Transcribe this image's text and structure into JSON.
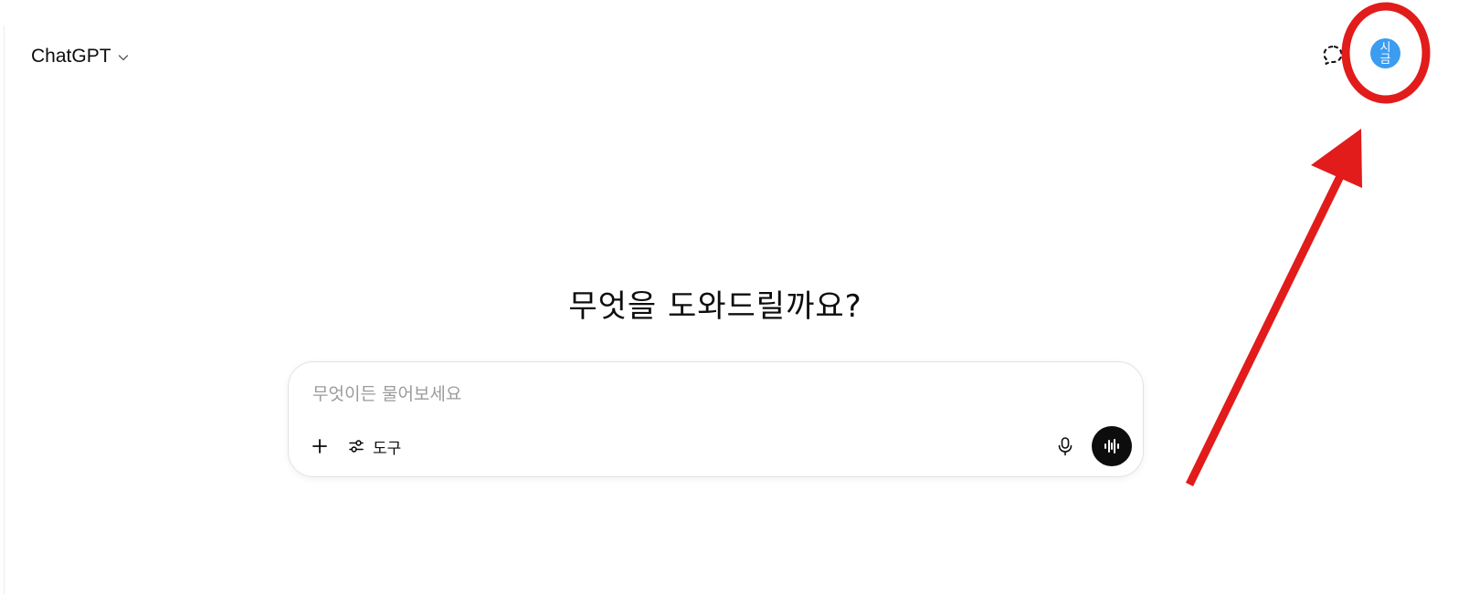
{
  "header": {
    "model_name": "ChatGPT",
    "avatar_text_line1": "시",
    "avatar_text_line2": "금"
  },
  "main": {
    "headline": "무엇을 도와드릴까요?",
    "composer": {
      "placeholder": "무엇이든 물어보세요",
      "value": "",
      "tools_label": "도구"
    }
  },
  "icons": {
    "model_chevron": "chevron-down-icon",
    "temporary_chat": "temporary-chat-icon",
    "plus": "plus-icon",
    "tools": "sliders-icon",
    "mic": "microphone-icon",
    "voice": "voice-mode-icon"
  },
  "colors": {
    "avatar_bg": "#3b9cf0",
    "annotation": "#e21b1b",
    "voice_button_bg": "#0d0d0d"
  }
}
